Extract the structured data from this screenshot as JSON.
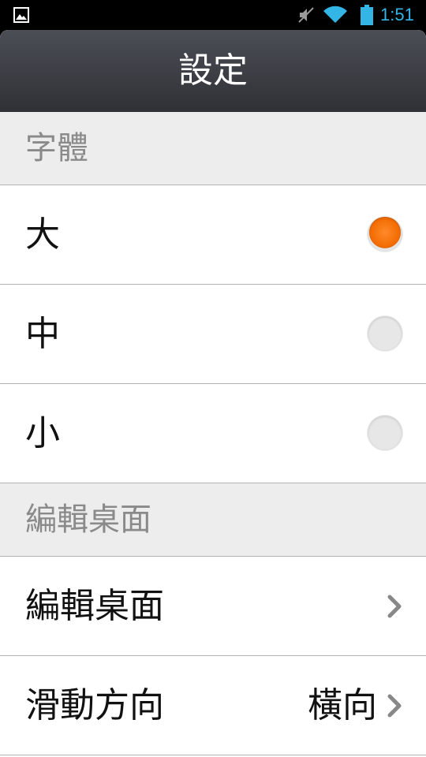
{
  "status_bar": {
    "time": "1:51",
    "time_color": "#33b5e5",
    "icons": [
      "gallery-icon",
      "mute-icon",
      "wifi-icon",
      "battery-icon"
    ]
  },
  "header": {
    "title": "設定"
  },
  "font_section": {
    "title": "字體",
    "options": [
      {
        "label": "大",
        "selected": true
      },
      {
        "label": "中",
        "selected": false
      },
      {
        "label": "小",
        "selected": false
      }
    ]
  },
  "desktop_section": {
    "title": "編輯桌面",
    "items": [
      {
        "label": "編輯桌面",
        "value": ""
      },
      {
        "label": "滑動方向",
        "value": "橫向"
      }
    ]
  },
  "colors": {
    "accent": "#f26a00",
    "header_bg": "#3a3c41"
  }
}
